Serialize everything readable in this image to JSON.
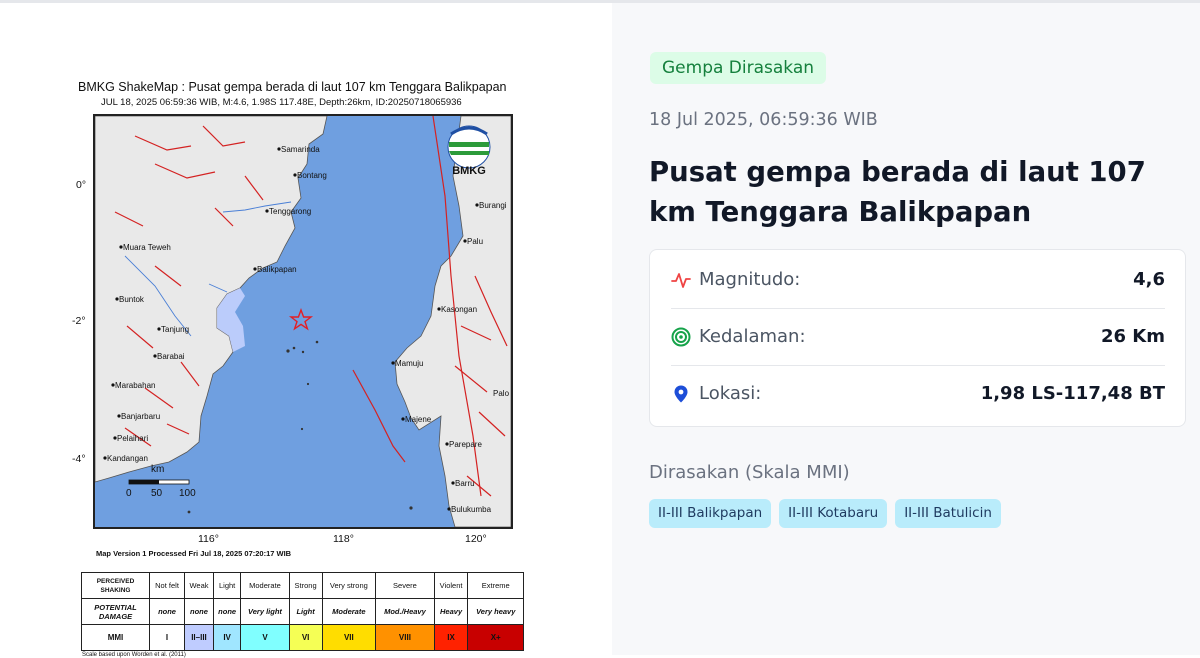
{
  "shakemap": {
    "title": "BMKG ShakeMap : Pusat gempa berada di laut 107 km Tenggara Balikpapan",
    "subtitle": "JUL 18, 2025 06:59:36 WIB, M:4.6, 1.98S 117.48E, Depth:26km, ID:20250718065936",
    "logo_text": "BMKG",
    "y_ticks": [
      "0°",
      "-2°",
      "-4°"
    ],
    "x_ticks": [
      "116°",
      "118°",
      "120°"
    ],
    "cities": [
      "Samarinda",
      "Bontang",
      "Tenggarong",
      "Muara Teweh",
      "Balikpapan",
      "Buntok",
      "Tanjung",
      "Barabai",
      "Marabahan",
      "Banjarbaru",
      "Pelaihari",
      "Kandangan",
      "Burangi",
      "Palu",
      "Kasongan",
      "Mamuju",
      "Majene",
      "Parepare",
      "Barru",
      "Bulukumba",
      "Palo"
    ],
    "scale_bar": {
      "unit": "km",
      "labels": [
        "0",
        "50",
        "100"
      ]
    },
    "map_version": "Map Version 1 Processed Fri Jul 18, 2025 07:20:17 WIB",
    "legend": {
      "row_headers": [
        "PERCEIVED SHAKING",
        "POTENTIAL DAMAGE",
        "MMI"
      ],
      "shaking": [
        "Not felt",
        "Weak",
        "Light",
        "Moderate",
        "Strong",
        "Very strong",
        "Severe",
        "Violent",
        "Extreme"
      ],
      "damage": [
        "none",
        "none",
        "none",
        "Very light",
        "Light",
        "Moderate",
        "Mod./Heavy",
        "Heavy",
        "Very heavy"
      ],
      "mmi": [
        "I",
        "II–III",
        "IV",
        "V",
        "VI",
        "VII",
        "VIII",
        "IX",
        "X+"
      ],
      "mmi_colors": [
        "#ffffff",
        "#bfccff",
        "#a0e6ff",
        "#80ffff",
        "#f5ff55",
        "#ffdd00",
        "#ff9100",
        "#ff2200",
        "#c80000"
      ]
    },
    "scale_note": "Scale based upon Worden et al. (2011)"
  },
  "panel": {
    "badge": "Gempa Dirasakan",
    "datetime": "18 Jul 2025, 06:59:36 WIB",
    "headline": "Pusat gempa berada di laut 107 km Tenggara Balikpapan",
    "details": [
      {
        "icon": "activity-icon",
        "label": "Magnitudo:",
        "value": "4,6"
      },
      {
        "icon": "target-icon",
        "label": "Kedalaman:",
        "value": "26 Km"
      },
      {
        "icon": "map-pin-icon",
        "label": "Lokasi:",
        "value": "1,98 LS-117,48 BT"
      }
    ],
    "felt_title": "Dirasakan (Skala MMI)",
    "felt_areas": [
      "II-III Balikpapan",
      "II-III Kotabaru",
      "II-III Batulicin"
    ]
  },
  "colors": {
    "badge_bg": "#dcfce7",
    "badge_text": "#15803d",
    "chip_bg": "#b9ecfb",
    "magnitude_icon": "#ef4444",
    "depth_icon": "#16a34a",
    "location_icon": "#1d4ed8"
  }
}
